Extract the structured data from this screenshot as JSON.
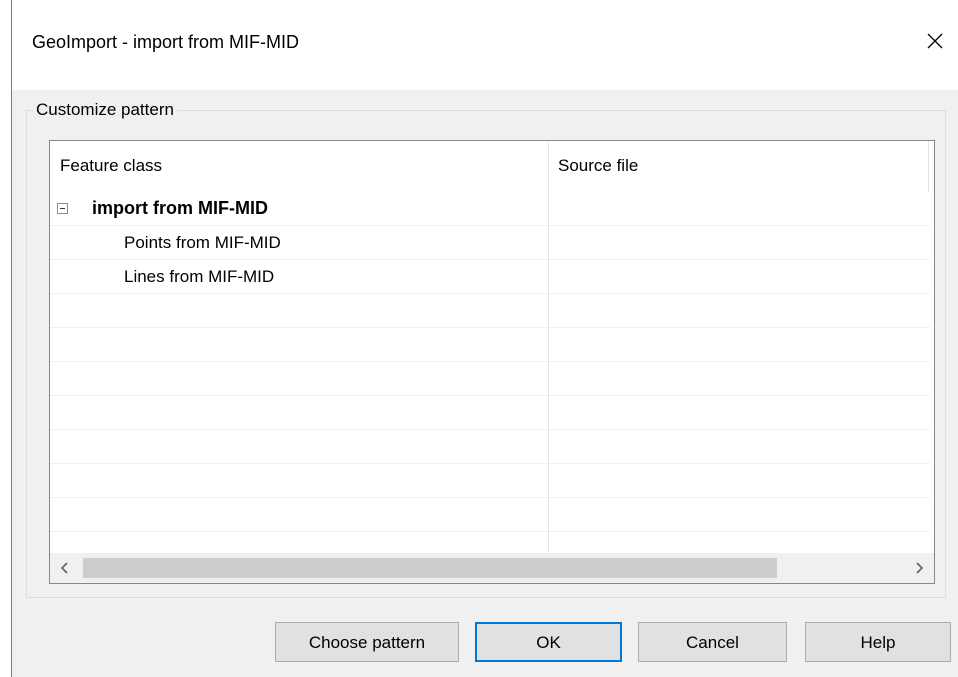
{
  "window": {
    "title": "GeoImport - import from MIF-MID",
    "close_icon": "close-icon"
  },
  "group": {
    "label": "Customize pattern"
  },
  "table": {
    "columns": [
      "Feature class",
      "Source file"
    ],
    "rows": [
      {
        "label": "import from MIF-MID",
        "source": "",
        "bold": true,
        "expander": "collapse-minus-icon",
        "level": 0
      },
      {
        "label": "Points from MIF-MID",
        "source": "",
        "bold": false,
        "level": 1
      },
      {
        "label": "Lines from MIF-MID",
        "source": "",
        "bold": false,
        "level": 1
      }
    ],
    "empty_rows": 8
  },
  "scrollbar": {
    "left_icon": "chevron-left-icon",
    "right_icon": "chevron-right-icon"
  },
  "buttons": {
    "choose_pattern": "Choose pattern",
    "ok": "OK",
    "cancel": "Cancel",
    "help": "Help"
  },
  "colors": {
    "accent": "#0078d7",
    "dialog_bg": "#f0f0f0"
  }
}
